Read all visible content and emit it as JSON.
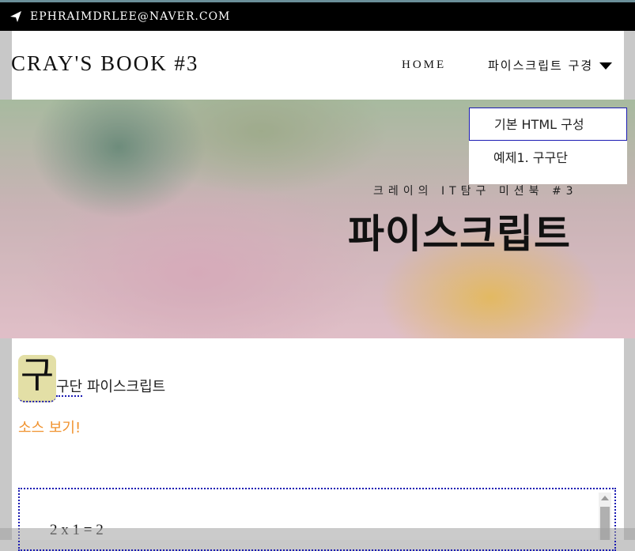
{
  "topbar": {
    "email": "EPHRAIMDRLEE@NAVER.COM",
    "icon": "paper-plane-icon"
  },
  "header": {
    "brand": "CRAY'S BOOK #3",
    "nav": {
      "home": "HOME",
      "javascript_menu": "파이스크립트 구경"
    }
  },
  "hero": {
    "subtitle": "크레이의 IT탐구 미션북 #3",
    "title": "파이스크립트"
  },
  "dropdown": {
    "items": [
      "기본 HTML 구성",
      "예제1. 구구단"
    ],
    "selected": "기본 HTML 구성"
  },
  "content": {
    "dropcap": "구",
    "heading_underlined": "구단",
    "heading_rest": " 파이스크립트",
    "source_link": "소스 보기!",
    "output_line": "2 x 1 = 2"
  },
  "colors": {
    "accent_orange": "#f0922e",
    "dropcap_bg": "#e3dfa6",
    "focus_border": "#1b1bb3"
  }
}
